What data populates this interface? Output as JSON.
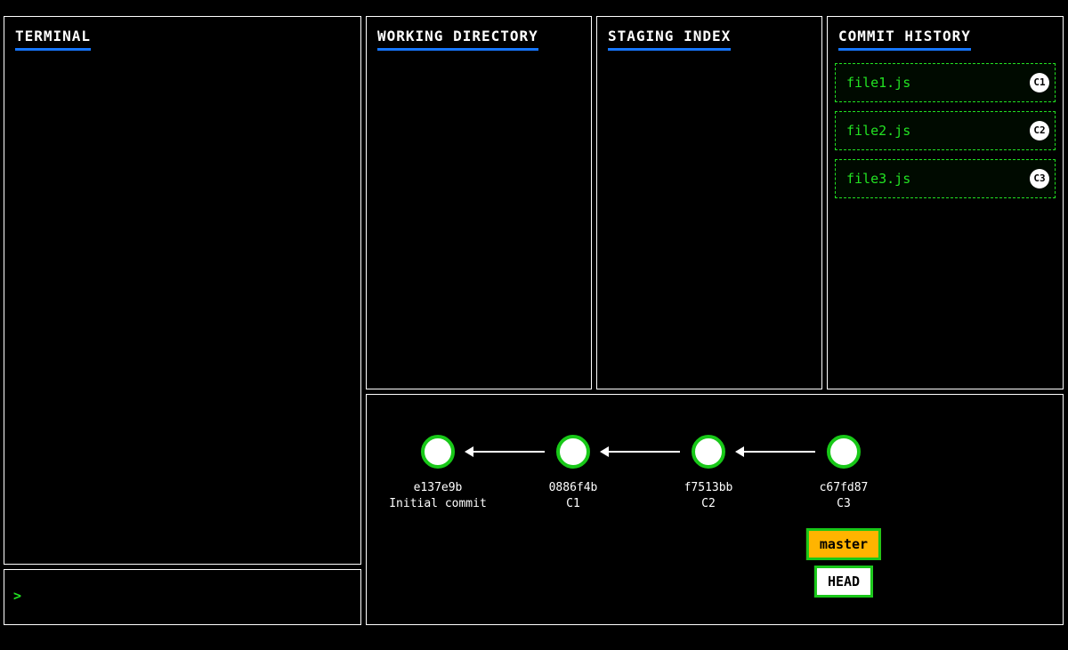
{
  "panels": {
    "terminal": "TERMINAL",
    "working": "WORKING DIRECTORY",
    "staging": "STAGING INDEX",
    "history": "COMMIT HISTORY"
  },
  "prompt": ">",
  "terminal_output": "",
  "history_files": [
    {
      "name": "file1.js",
      "badge": "C1"
    },
    {
      "name": "file2.js",
      "badge": "C2"
    },
    {
      "name": "file3.js",
      "badge": "C3"
    }
  ],
  "commits": [
    {
      "hash": "e137e9b",
      "msg": "Initial commit"
    },
    {
      "hash": "0886f4b",
      "msg": "C1"
    },
    {
      "hash": "f7513bb",
      "msg": "C2"
    },
    {
      "hash": "c67fd87",
      "msg": "C3"
    }
  ],
  "refs": {
    "master": "master",
    "head": "HEAD"
  }
}
